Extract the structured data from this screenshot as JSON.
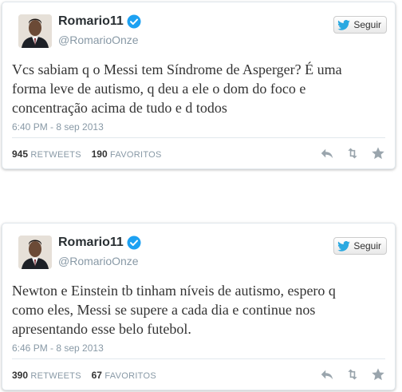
{
  "tweets": [
    {
      "display_name": "Romario11",
      "screen_name": "@RomarioOnze",
      "follow_label": "Seguir",
      "text": "Vcs sabiam q o Messi tem Síndrome de Asperger? É uma\nforma leve de autismo, q deu a ele o dom do foco e\nconcentração acima de tudo e d todos",
      "timestamp": "6:40 PM - 8 sep 2013",
      "retweets_count": "945",
      "retweets_label": "RETWEETS",
      "favorites_count": "190",
      "favorites_label": "FAVORITOS"
    },
    {
      "display_name": "Romario11",
      "screen_name": "@RomarioOnze",
      "follow_label": "Seguir",
      "text": "Newton e Einstein tb tinham níveis de autismo, espero q\ncomo eles, Messi se supere a cada dia e continue nos\napresentando esse belo futebol.",
      "timestamp": "6:46 PM - 8 sep 2013",
      "retweets_count": "390",
      "retweets_label": "RETWEETS",
      "favorites_count": "67",
      "favorites_label": "FAVORITOS"
    }
  ],
  "colors": {
    "verified_blue": "#1da1f2",
    "bird_blue": "#2ba9e1",
    "muted_gray": "#8899a6",
    "icon_gray": "#9aa5ad"
  },
  "icons": {
    "verified": "verified-badge-icon",
    "bird": "twitter-bird-icon",
    "reply": "reply-icon",
    "retweet": "retweet-icon",
    "favorite": "star-icon"
  }
}
